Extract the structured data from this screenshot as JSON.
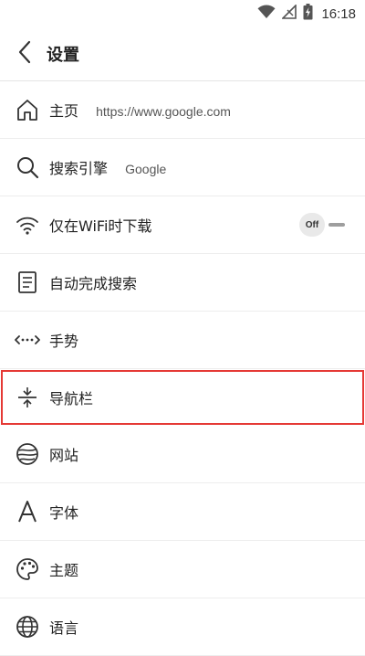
{
  "status_bar": {
    "time": "16:18"
  },
  "header": {
    "title": "设置"
  },
  "settings": {
    "homepage": {
      "label": "主页",
      "value": "https://www.google.com"
    },
    "search_engine": {
      "label": "搜索引擎",
      "value": "Google"
    },
    "wifi_only": {
      "label": "仅在WiFi时下载",
      "toggle_state": "Off"
    },
    "autocomplete": {
      "label": "自动完成搜索"
    },
    "gestures": {
      "label": "手势"
    },
    "navbar": {
      "label": "导航栏"
    },
    "websites": {
      "label": "网站"
    },
    "font": {
      "label": "字体"
    },
    "theme": {
      "label": "主题"
    },
    "language": {
      "label": "语言"
    }
  },
  "colors": {
    "highlight": "#e53935",
    "divider": "#ededed"
  },
  "icons": [
    "wifi-icon",
    "signal-icon",
    "battery-icon",
    "back-icon",
    "home-icon",
    "search-icon",
    "wifi-icon",
    "list-icon",
    "gesture-icon",
    "navbar-icon",
    "globe-stripes-icon",
    "font-icon",
    "palette-icon",
    "globe-icon"
  ]
}
